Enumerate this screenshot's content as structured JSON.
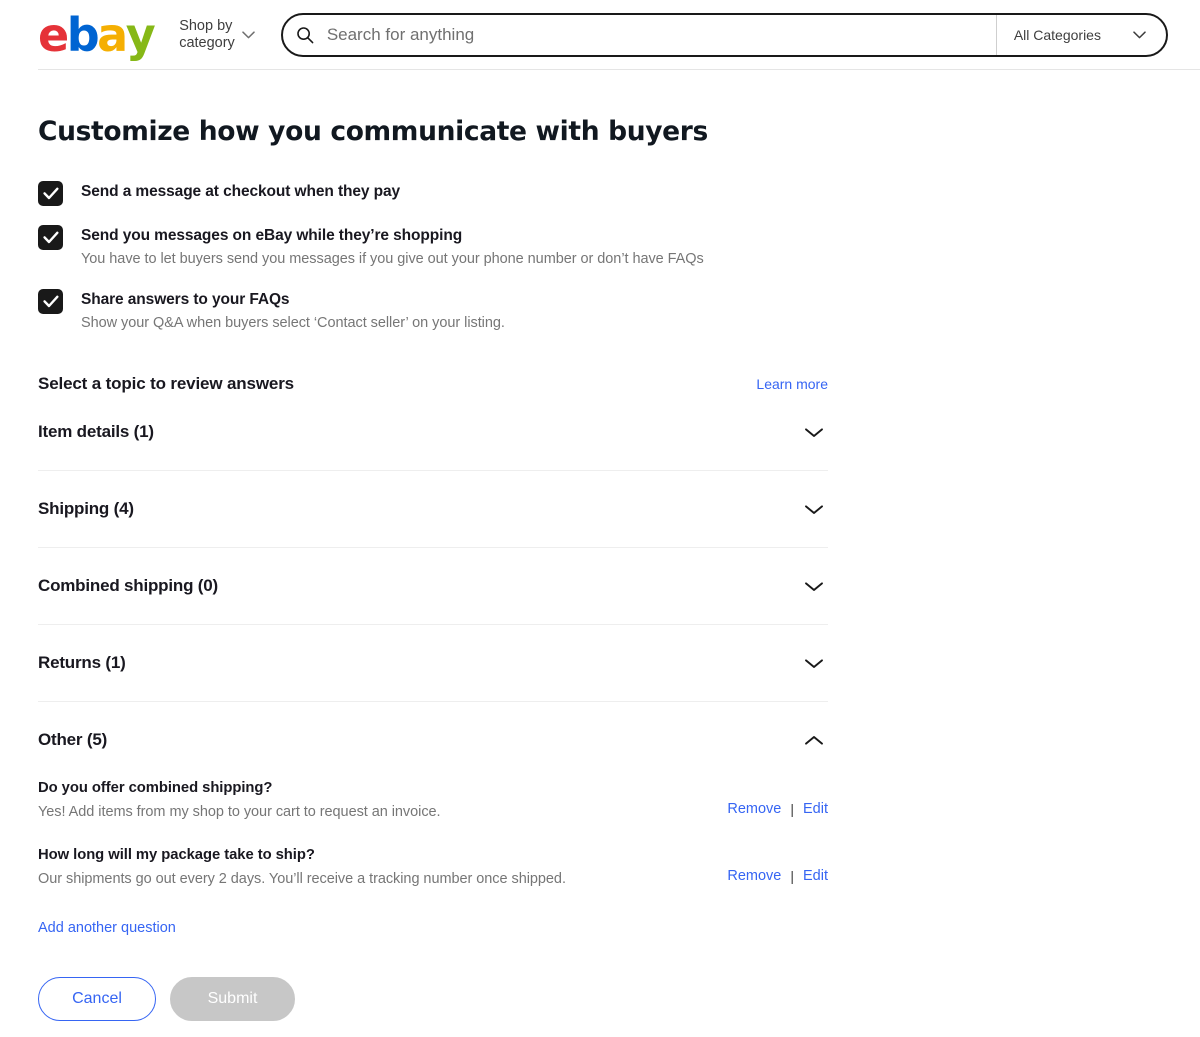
{
  "header": {
    "logo": {
      "letters": [
        {
          "char": "e",
          "color": "#e53238"
        },
        {
          "char": "b",
          "color": "#0064d2"
        },
        {
          "char": "a",
          "color": "#f5af02"
        },
        {
          "char": "y",
          "color": "#86b817"
        }
      ]
    },
    "shop_by_category": "Shop by\ncategory",
    "shop_by_category_icon": "chevron-down-icon",
    "search": {
      "icon": "search-icon",
      "placeholder": "Search for anything",
      "value": ""
    },
    "category_select": {
      "selected": "All Categories",
      "icon": "chevron-down-icon"
    }
  },
  "main": {
    "page_title": "Customize how you communicate with buyers",
    "checkboxes": [
      {
        "label": "Send a message at checkout when they pay",
        "description": "",
        "checked": true
      },
      {
        "label": "Send you messages on eBay while they’re shopping",
        "description": "You have to let buyers send you messages if you give out your phone number or don’t have FAQs",
        "checked": true
      },
      {
        "label": "Share answers to your FAQs",
        "description": "Show your Q&A when buyers select ‘Contact seller’ on your listing.",
        "checked": true
      }
    ],
    "topics": {
      "title": "Select a topic to review answers",
      "learn_more_label": "Learn more",
      "sections": [
        {
          "title": "Item details (1)",
          "expanded": false,
          "icon": "chevron-down-icon",
          "items": []
        },
        {
          "title": "Shipping (4)",
          "expanded": false,
          "icon": "chevron-down-icon",
          "items": []
        },
        {
          "title": "Combined shipping (0)",
          "expanded": false,
          "icon": "chevron-down-icon",
          "items": []
        },
        {
          "title": "Returns (1)",
          "expanded": false,
          "icon": "chevron-down-icon",
          "items": []
        },
        {
          "title": "Other (5)",
          "expanded": true,
          "icon": "chevron-up-icon",
          "items": [
            {
              "question": "Do you offer combined shipping?",
              "answer": "Yes! Add items from my shop to your cart to request an invoice.",
              "remove_label": "Remove",
              "separator": "|",
              "edit_label": "Edit"
            },
            {
              "question": "How long will my package take to ship?",
              "answer": "Our shipments go out every 2 days. You’ll receive a tracking number once shipped.",
              "remove_label": "Remove",
              "separator": "|",
              "edit_label": "Edit"
            }
          ]
        }
      ],
      "add_question_label": "Add another question"
    },
    "actions": {
      "cancel_label": "Cancel",
      "submit_label": "Submit",
      "submit_disabled": true
    }
  },
  "colors": {
    "link_blue": "#3665f3",
    "text_dark": "#191820",
    "text_muted": "#767676",
    "checkbox_fill": "#191919",
    "submit_disabled_bg": "#c7c7c7",
    "divider": "#eeeeee"
  }
}
